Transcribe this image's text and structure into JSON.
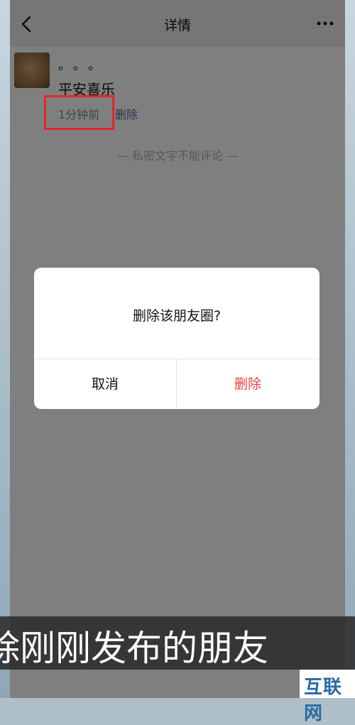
{
  "header": {
    "title": "详情"
  },
  "post": {
    "dots": "。。。",
    "text": "平安喜乐",
    "time": "1分钟前",
    "delete_link": "删除",
    "private_note": "— 私密文字不能评论 —"
  },
  "dialog": {
    "title": "删除该朋友圈?",
    "cancel_label": "取消",
    "delete_label": "删除"
  },
  "caption": "除刚刚发布的朋友",
  "watermark": "互联网",
  "colors": {
    "delete_red": "#e64340",
    "link_blue": "#576b95",
    "highlight_box": "#e3262b"
  }
}
